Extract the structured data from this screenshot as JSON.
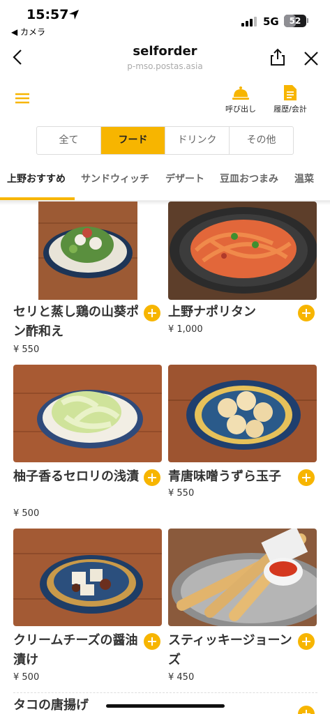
{
  "status_bar": {
    "time": "15:57",
    "back_app": "◀ カメラ",
    "network": "5G",
    "battery": "52"
  },
  "browser": {
    "title": "selforder",
    "url": "p-mso.postas.asia"
  },
  "toolbar": {
    "call_label": "呼び出し",
    "history_label": "履歴/会計"
  },
  "segments": [
    {
      "label": "全て",
      "active": false
    },
    {
      "label": "フード",
      "active": true
    },
    {
      "label": "ドリンク",
      "active": false
    },
    {
      "label": "その他",
      "active": false
    }
  ],
  "categories": [
    "上野おすすめ",
    "サンドウィッチ",
    "デザート",
    "豆皿おつまみ",
    "温菜"
  ],
  "items": [
    {
      "name": "セリと蒸し鶏の山葵ポン酢和え",
      "price": "¥ 550"
    },
    {
      "name": "上野ナポリタン",
      "price": "¥ 1,000"
    },
    {
      "name": "柚子香るセロリの浅漬",
      "price": "¥ 500"
    },
    {
      "name": "青唐味噌うずら玉子",
      "price": "¥ 550"
    },
    {
      "name": "クリームチーズの醤油漬け",
      "price": "¥ 500"
    },
    {
      "name": "スティッキージョーンズ",
      "price": "¥ 450"
    },
    {
      "name": "タコの唐揚げ",
      "price": ""
    }
  ],
  "colors": {
    "accent": "#f7b500",
    "wood": "#a0522d"
  }
}
